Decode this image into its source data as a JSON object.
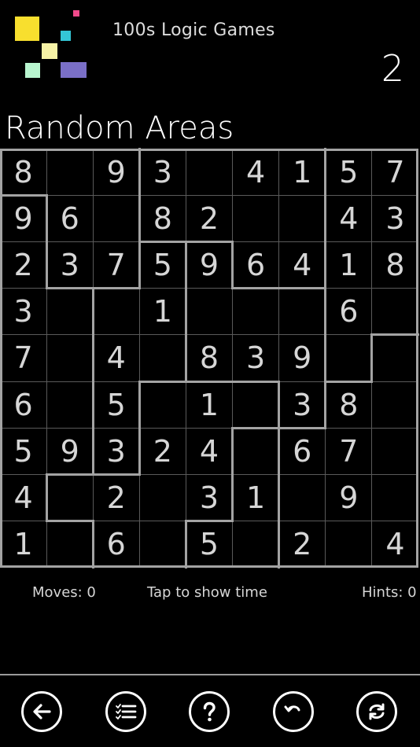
{
  "header": {
    "app_name": "100s Logic Games",
    "level_number": "2"
  },
  "logo": {
    "squares": [
      {
        "color": "#f8df2e"
      },
      {
        "color": "#f04a8a"
      },
      {
        "color": "#34c6d6"
      },
      {
        "color": "#f7f3a6"
      },
      {
        "color": "#b8f5cf"
      },
      {
        "color": "#7a6fc7"
      }
    ]
  },
  "puzzle": {
    "title": "Random Areas",
    "size": 9,
    "grid": [
      [
        "8",
        "",
        "9",
        "3",
        "",
        "4",
        "1",
        "5",
        "7"
      ],
      [
        "9",
        "6",
        "",
        "8",
        "2",
        "",
        "",
        "4",
        "3"
      ],
      [
        "2",
        "3",
        "7",
        "5",
        "9",
        "6",
        "4",
        "1",
        "8"
      ],
      [
        "3",
        "",
        "",
        "1",
        "",
        "",
        "",
        "6",
        ""
      ],
      [
        "7",
        "",
        "4",
        "",
        "8",
        "3",
        "9",
        "",
        ""
      ],
      [
        "6",
        "",
        "5",
        "",
        "1",
        "",
        "3",
        "8",
        ""
      ],
      [
        "5",
        "9",
        "3",
        "2",
        "4",
        "",
        "6",
        "7",
        ""
      ],
      [
        "4",
        "",
        "2",
        "",
        "3",
        "1",
        "",
        "9",
        ""
      ],
      [
        "1",
        "",
        "6",
        "",
        "5",
        "",
        "2",
        "",
        "4"
      ]
    ],
    "regions": [
      [
        0,
        0,
        0,
        1,
        1,
        1,
        1,
        2,
        2
      ],
      [
        3,
        0,
        0,
        1,
        1,
        1,
        1,
        2,
        2
      ],
      [
        3,
        0,
        0,
        4,
        5,
        1,
        1,
        2,
        2
      ],
      [
        3,
        3,
        4,
        4,
        5,
        5,
        5,
        2,
        2
      ],
      [
        3,
        3,
        4,
        4,
        5,
        5,
        5,
        2,
        6
      ],
      [
        3,
        3,
        4,
        7,
        7,
        7,
        5,
        6,
        6
      ],
      [
        3,
        3,
        4,
        7,
        7,
        8,
        6,
        6,
        6
      ],
      [
        3,
        7,
        7,
        7,
        7,
        8,
        6,
        6,
        6
      ],
      [
        3,
        3,
        7,
        7,
        8,
        8,
        6,
        6,
        6
      ]
    ]
  },
  "status": {
    "moves": "Moves: 0",
    "timer": "Tap to show time",
    "hints": "Hints: 0"
  },
  "toolbar": {
    "icons": [
      "back-icon",
      "list-icon",
      "help-icon",
      "undo-icon",
      "refresh-icon"
    ]
  }
}
